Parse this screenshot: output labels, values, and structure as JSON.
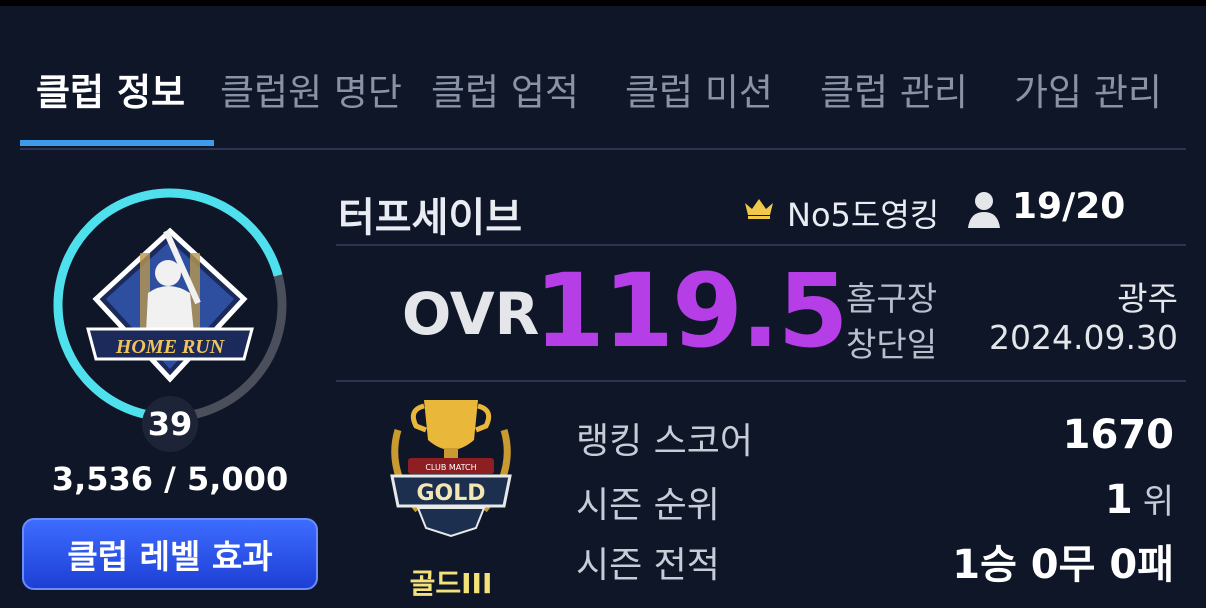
{
  "tabs": [
    "클럽 정보",
    "클럽원 명단",
    "클럽 업적",
    "클럽 미션",
    "클럽 관리",
    "가입 관리"
  ],
  "club": {
    "emblem_text": "HOME RUN",
    "level": "39",
    "exp_text": "3,536 / 5,000",
    "exp_progress": 0.7072,
    "level_button": "클럽 레벨 효과",
    "name": "터프세이브",
    "leader": "No5도영킹",
    "members": "19/20"
  },
  "ovr": {
    "label": "OVR",
    "value": "119.5"
  },
  "info": {
    "home_label": "홈구장",
    "home_value": "광주",
    "founded_label": "창단일",
    "founded_value": "2024.09.30"
  },
  "rank": {
    "badge_top": "CLUB MATCH",
    "badge_text": "GOLD",
    "tier": "골드III",
    "score_label": "랭킹 스코어",
    "score_value": "1670",
    "season_rank_label": "시즌 순위",
    "season_rank_value": "1",
    "season_rank_unit": "위",
    "record_label": "시즌 전적",
    "record_value": "1승 0무 0패"
  },
  "colors": {
    "accent": "#3d9be9",
    "ovr": "#b53ee6",
    "ring": "#4fe0ee",
    "tier": "#f3e27a"
  }
}
